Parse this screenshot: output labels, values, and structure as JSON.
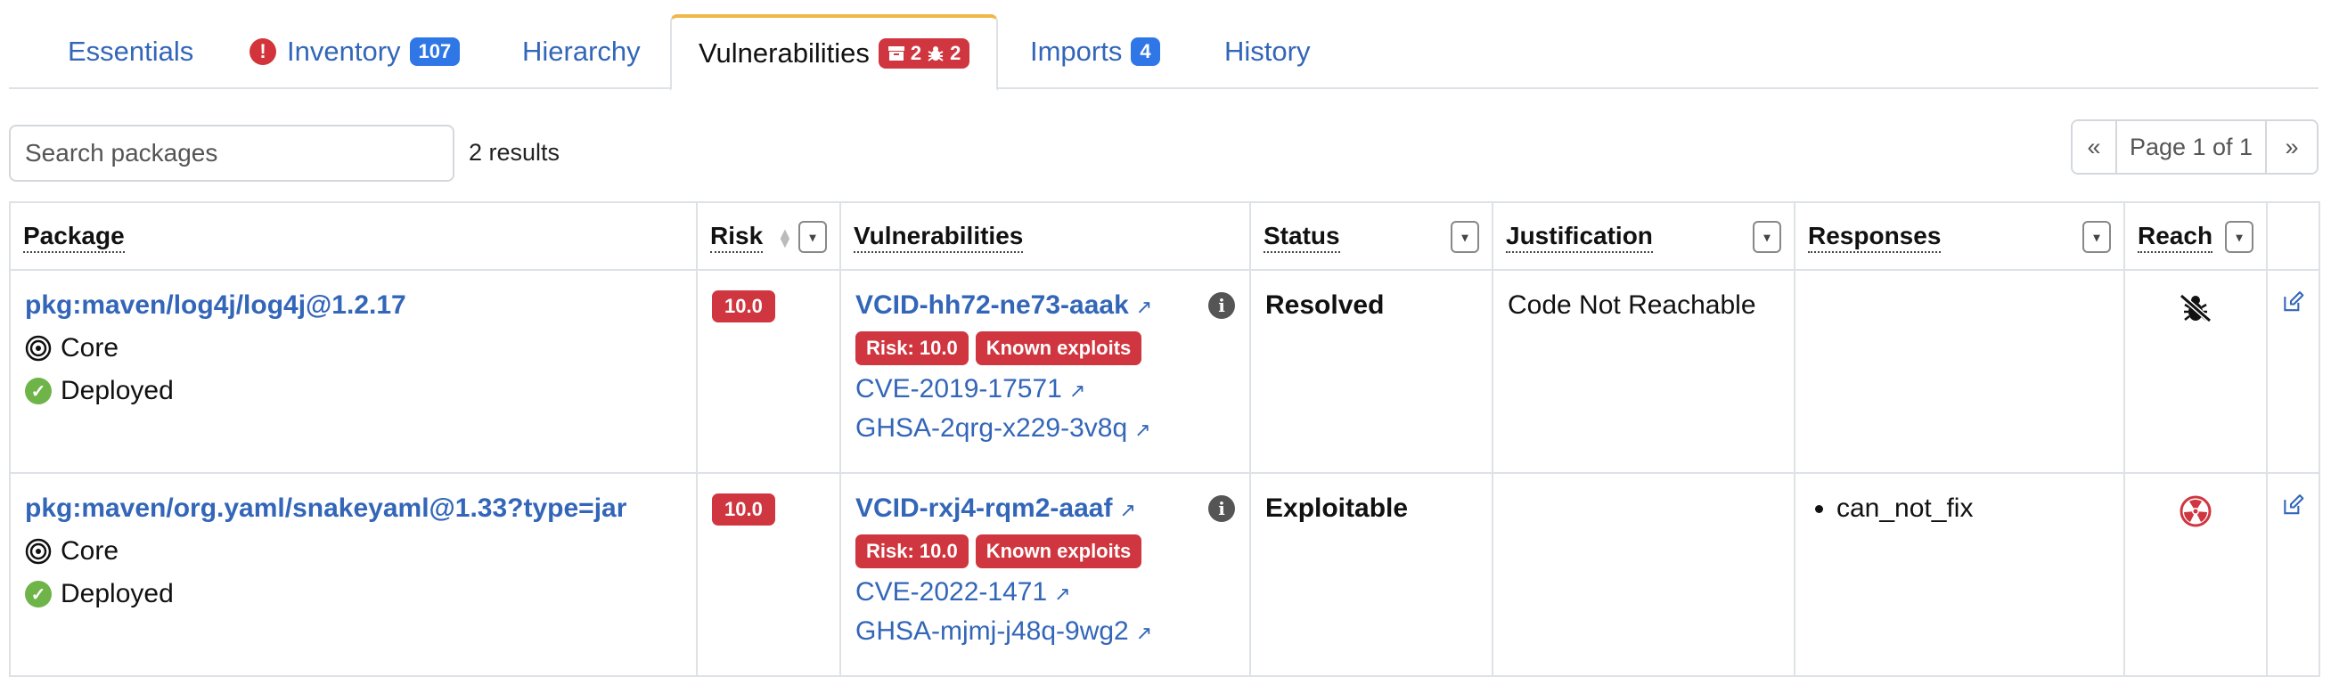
{
  "tabs": [
    {
      "label": "Essentials"
    },
    {
      "label": "Inventory",
      "badge": "107",
      "alert": "!"
    },
    {
      "label": "Hierarchy"
    },
    {
      "label": "Vulnerabilities",
      "badge_a": "2",
      "badge_b": "2"
    },
    {
      "label": "Imports",
      "badge": "4"
    },
    {
      "label": "History"
    }
  ],
  "search": {
    "placeholder": "Search packages",
    "value": ""
  },
  "results": "2 results",
  "pager": {
    "first": "«",
    "page": "Page 1 of 1",
    "last": "»"
  },
  "table": {
    "headers": {
      "package": "Package",
      "risk": "Risk",
      "vulnerabilities": "Vulnerabilities",
      "status": "Status",
      "justification": "Justification",
      "responses": "Responses",
      "reach": "Reach"
    },
    "rows": [
      {
        "package": "pkg:maven/log4j/log4j@1.2.17",
        "scope": "Core",
        "state": "Deployed",
        "risk": "10.0",
        "vuln_id": "VCID-hh72-ne73-aaak",
        "vuln_risk": "Risk: 10.0",
        "vuln_exploit": "Known exploits",
        "aliases": [
          "CVE-2019-17571",
          "GHSA-2qrg-x229-3v8q"
        ],
        "status": "Resolved",
        "justification": "Code Not Reachable",
        "responses": [],
        "reach_icon": "not-reachable-bug-icon"
      },
      {
        "package": "pkg:maven/org.yaml/snakeyaml@1.33?type=jar",
        "scope": "Core",
        "state": "Deployed",
        "risk": "10.0",
        "vuln_id": "VCID-rxj4-rqm2-aaaf",
        "vuln_risk": "Risk: 10.0",
        "vuln_exploit": "Known exploits",
        "aliases": [
          "CVE-2022-1471",
          "GHSA-mjmj-j48q-9wg2"
        ],
        "status": "Exploitable",
        "justification": "",
        "responses": [
          "can_not_fix"
        ],
        "reach_icon": "radiation-icon"
      }
    ]
  },
  "colors": {
    "link": "#3366b8",
    "danger": "#d0363f",
    "badge": "#2f76e6",
    "active_tab_accent": "#f0b74b",
    "ok": "#6eb449"
  }
}
